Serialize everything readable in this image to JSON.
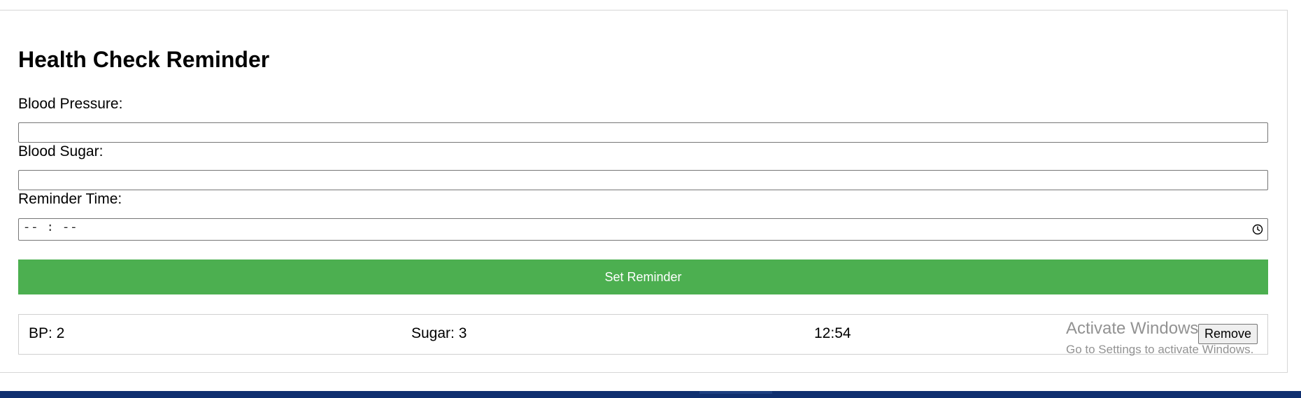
{
  "app": {
    "title": "Health Check Reminder"
  },
  "form": {
    "blood_pressure": {
      "label": "Blood Pressure:",
      "value": ""
    },
    "blood_sugar": {
      "label": "Blood Sugar:",
      "value": ""
    },
    "reminder_time": {
      "label": "Reminder Time:",
      "placeholder_display": "-- : --"
    },
    "submit_label": "Set Reminder"
  },
  "reminders": [
    {
      "bp": "BP: 2",
      "sugar": "Sugar: 3",
      "time": "12:54",
      "remove_label": "Remove"
    }
  ],
  "watermark": {
    "title": "Activate Windows",
    "subtitle": "Go to Settings to activate Windows."
  },
  "colors": {
    "accent": "#4caf50",
    "taskbar": "#0f2f6f"
  },
  "icons": {
    "time_picker": "clock-icon"
  }
}
